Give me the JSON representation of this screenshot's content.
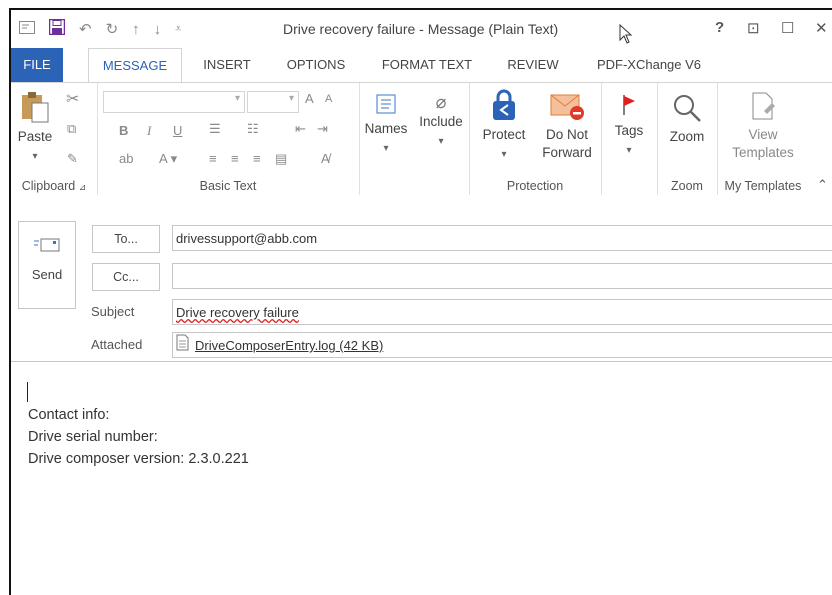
{
  "window": {
    "title": "Drive recovery failure - Message (Plain Text)",
    "controls": {
      "help": "?",
      "ribbon_display": "⊡",
      "maximize": "☐",
      "close": "✕"
    }
  },
  "tabs": [
    "FILE",
    "MESSAGE",
    "INSERT",
    "OPTIONS",
    "FORMAT TEXT",
    "REVIEW",
    "PDF-XChange V6"
  ],
  "ribbon": {
    "clipboard": {
      "paste": "Paste",
      "label": "Clipboard"
    },
    "basic_text": {
      "label": "Basic Text",
      "bold": "B",
      "italic": "I",
      "underline": "U",
      "grow": "A",
      "shrink": "A"
    },
    "names": {
      "label": "Names"
    },
    "include": {
      "label": "Include"
    },
    "protection": {
      "protect": "Protect",
      "donot_line1": "Do Not",
      "donot_line2": "Forward",
      "label": "Protection"
    },
    "tags": {
      "label": "Tags"
    },
    "zoom": {
      "button": "Zoom",
      "label": "Zoom"
    },
    "templates": {
      "line1": "View",
      "line2": "Templates",
      "label": "My Templates"
    }
  },
  "header": {
    "send_label": "Send",
    "to_button": "To...",
    "to_value": "drivessupport@abb.com",
    "cc_button": "Cc...",
    "cc_value": "",
    "subject_label": "Subject",
    "subject_value": "Drive recovery failure",
    "attached_label": "Attached",
    "attachment_name": "DriveComposerEntry.log (42 KB)"
  },
  "body": {
    "line1": "Contact info:",
    "line2": "Drive serial number:",
    "line3": "Drive composer version: 2.3.0.221"
  },
  "colors": {
    "accent": "#2b63b6",
    "protect_blue": "#2b63b6",
    "donot_orange": "#e57b3a",
    "flag_red": "#e02020"
  }
}
